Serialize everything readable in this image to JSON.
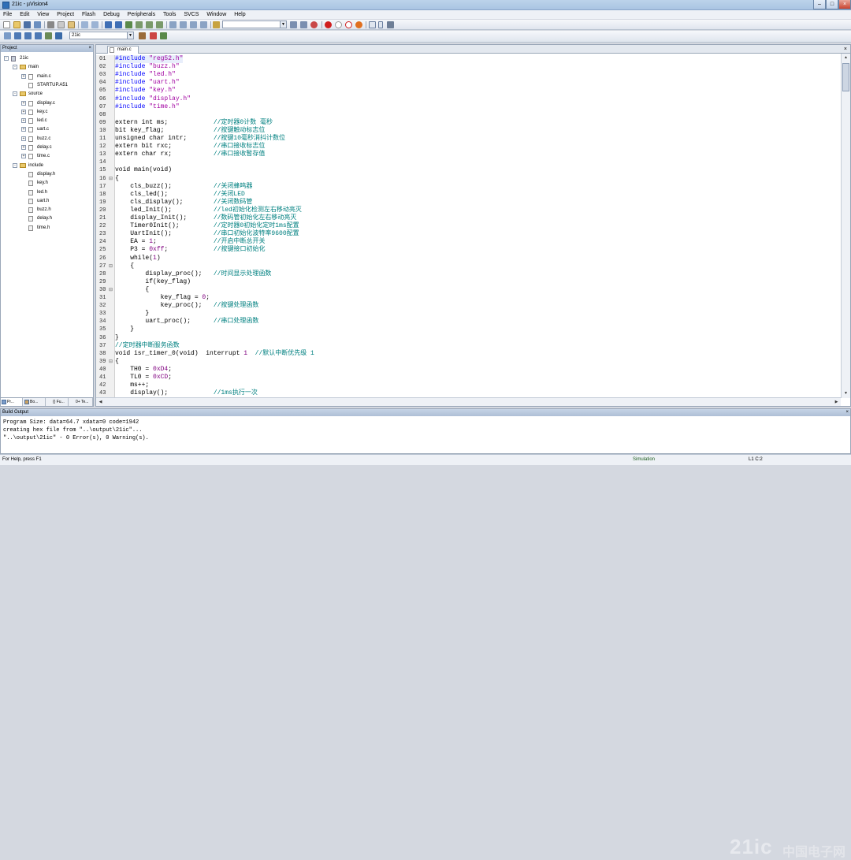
{
  "window": {
    "title": "21ic - µVision4"
  },
  "menu": [
    "File",
    "Edit",
    "View",
    "Project",
    "Flash",
    "Debug",
    "Peripherals",
    "Tools",
    "SVCS",
    "Window",
    "Help"
  ],
  "toolbar2": {
    "target": "21ic"
  },
  "project_pane": {
    "title": "Project",
    "tree": [
      {
        "label": "21ic",
        "level": 0,
        "type": "proj",
        "exp": "-"
      },
      {
        "label": "main",
        "level": 1,
        "type": "fold",
        "exp": "-"
      },
      {
        "label": "main.c",
        "level": 2,
        "type": "file",
        "exp": "+"
      },
      {
        "label": "STARTUP.A51",
        "level": 2,
        "type": "file",
        "exp": ""
      },
      {
        "label": "source",
        "level": 1,
        "type": "fold",
        "exp": "-"
      },
      {
        "label": "display.c",
        "level": 2,
        "type": "file",
        "exp": "+"
      },
      {
        "label": "key.c",
        "level": 2,
        "type": "file",
        "exp": "+"
      },
      {
        "label": "led.c",
        "level": 2,
        "type": "file",
        "exp": "+"
      },
      {
        "label": "uart.c",
        "level": 2,
        "type": "file",
        "exp": "+"
      },
      {
        "label": "buzz.c",
        "level": 2,
        "type": "file",
        "exp": "+"
      },
      {
        "label": "delay.c",
        "level": 2,
        "type": "file",
        "exp": "+"
      },
      {
        "label": "time.c",
        "level": 2,
        "type": "file",
        "exp": "+"
      },
      {
        "label": "include",
        "level": 1,
        "type": "fold",
        "exp": "-"
      },
      {
        "label": "display.h",
        "level": 2,
        "type": "hdr",
        "exp": ""
      },
      {
        "label": "key.h",
        "level": 2,
        "type": "hdr",
        "exp": ""
      },
      {
        "label": "led.h",
        "level": 2,
        "type": "hdr",
        "exp": ""
      },
      {
        "label": "uart.h",
        "level": 2,
        "type": "hdr",
        "exp": ""
      },
      {
        "label": "buzz.h",
        "level": 2,
        "type": "hdr",
        "exp": ""
      },
      {
        "label": "delay.h",
        "level": 2,
        "type": "hdr",
        "exp": ""
      },
      {
        "label": "time.h",
        "level": 2,
        "type": "hdr",
        "exp": ""
      }
    ],
    "tabs": [
      "Pr...",
      "Bo...",
      "{} Fu...",
      "0+ Te..."
    ]
  },
  "editor": {
    "tab": "main.c",
    "lines": [
      {
        "n": "01",
        "fold": "",
        "segs": [
          [
            "kw",
            "#include "
          ],
          [
            "str",
            "\"reg52.h\""
          ]
        ]
      },
      {
        "n": "02",
        "fold": "",
        "segs": [
          [
            "kw",
            "#include "
          ],
          [
            "str",
            "\"buzz.h\""
          ]
        ]
      },
      {
        "n": "03",
        "fold": "",
        "segs": [
          [
            "kw",
            "#include "
          ],
          [
            "str",
            "\"led.h\""
          ]
        ]
      },
      {
        "n": "04",
        "fold": "",
        "segs": [
          [
            "kw",
            "#include "
          ],
          [
            "str",
            "\"uart.h\""
          ]
        ]
      },
      {
        "n": "05",
        "fold": "",
        "segs": [
          [
            "kw",
            "#include "
          ],
          [
            "str",
            "\"key.h\""
          ]
        ]
      },
      {
        "n": "06",
        "fold": "",
        "segs": [
          [
            "kw",
            "#include "
          ],
          [
            "str",
            "\"display.h\""
          ]
        ]
      },
      {
        "n": "07",
        "fold": "",
        "segs": [
          [
            "kw",
            "#include "
          ],
          [
            "str",
            "\"time.h\""
          ]
        ]
      },
      {
        "n": "08",
        "fold": "",
        "segs": []
      },
      {
        "n": "09",
        "fold": "",
        "segs": [
          [
            "b",
            "extern int ms;            "
          ],
          [
            "cm",
            "//定时器0计数 毫秒"
          ]
        ]
      },
      {
        "n": "10",
        "fold": "",
        "segs": [
          [
            "b",
            "bit key_flag;             "
          ],
          [
            "cm",
            "//按键触动标志位"
          ]
        ]
      },
      {
        "n": "11",
        "fold": "",
        "segs": [
          [
            "b",
            "unsigned char intr;       "
          ],
          [
            "cm",
            "//按键10毫秒消抖计数位"
          ]
        ]
      },
      {
        "n": "12",
        "fold": "",
        "segs": [
          [
            "b",
            "extern bit rxc;           "
          ],
          [
            "cm",
            "//串口接收标志位"
          ]
        ]
      },
      {
        "n": "13",
        "fold": "",
        "segs": [
          [
            "b",
            "extern char rx;           "
          ],
          [
            "cm",
            "//串口接收暂存值"
          ]
        ]
      },
      {
        "n": "14",
        "fold": "",
        "segs": []
      },
      {
        "n": "15",
        "fold": "",
        "segs": [
          [
            "b",
            "void main(void)"
          ]
        ]
      },
      {
        "n": "16",
        "fold": "⊟",
        "segs": [
          [
            "t",
            "{"
          ]
        ]
      },
      {
        "n": "17",
        "fold": "",
        "segs": [
          [
            "t",
            "    cls_buzz();           "
          ],
          [
            "cm",
            "//关闭蜂鸣器"
          ]
        ]
      },
      {
        "n": "18",
        "fold": "",
        "segs": [
          [
            "t",
            "    cls_led();            "
          ],
          [
            "cm",
            "//关闭LED"
          ]
        ]
      },
      {
        "n": "19",
        "fold": "",
        "segs": [
          [
            "t",
            "    cls_display();        "
          ],
          [
            "cm",
            "//关闭数码管"
          ]
        ]
      },
      {
        "n": "20",
        "fold": "",
        "segs": [
          [
            "t",
            "    led_Init();           "
          ],
          [
            "cm",
            "//led初始化检测左右移动亮灭"
          ]
        ]
      },
      {
        "n": "21",
        "fold": "",
        "segs": [
          [
            "t",
            "    display_Init();       "
          ],
          [
            "cm",
            "//数码管初始化左右移动亮灭"
          ]
        ]
      },
      {
        "n": "22",
        "fold": "",
        "segs": [
          [
            "t",
            "    Timer0Init();         "
          ],
          [
            "cm",
            "//定时器0初始化定时1ms配置"
          ]
        ]
      },
      {
        "n": "23",
        "fold": "",
        "segs": [
          [
            "t",
            "    UartInit();           "
          ],
          [
            "cm",
            "//串口初始化波特率9600配置"
          ]
        ]
      },
      {
        "n": "24",
        "fold": "",
        "segs": [
          [
            "t",
            "    EA = "
          ],
          [
            "num",
            "1"
          ],
          [
            "t",
            ";               "
          ],
          [
            "cm",
            "//开启中断总开关"
          ]
        ]
      },
      {
        "n": "25",
        "fold": "",
        "segs": [
          [
            "t",
            "    P3 = "
          ],
          [
            "num",
            "0xff"
          ],
          [
            "t",
            ";            "
          ],
          [
            "cm",
            "//按键接口初始化"
          ]
        ]
      },
      {
        "n": "26",
        "fold": "",
        "segs": [
          [
            "b",
            "    while"
          ],
          [
            "t",
            "("
          ],
          [
            "num",
            "1"
          ],
          [
            "t",
            ")"
          ]
        ]
      },
      {
        "n": "27",
        "fold": "⊟",
        "segs": [
          [
            "t",
            "    {"
          ]
        ]
      },
      {
        "n": "28",
        "fold": "",
        "segs": [
          [
            "t",
            "        display_proc();   "
          ],
          [
            "cm",
            "//时间显示处理函数"
          ]
        ]
      },
      {
        "n": "29",
        "fold": "",
        "segs": [
          [
            "b",
            "        if"
          ],
          [
            "t",
            "(key_flag)"
          ]
        ]
      },
      {
        "n": "30",
        "fold": "⊟",
        "segs": [
          [
            "t",
            "        {"
          ]
        ]
      },
      {
        "n": "31",
        "fold": "",
        "segs": [
          [
            "t",
            "            key_flag = "
          ],
          [
            "num",
            "0"
          ],
          [
            "t",
            ";"
          ]
        ]
      },
      {
        "n": "32",
        "fold": "",
        "segs": [
          [
            "t",
            "            key_proc();   "
          ],
          [
            "cm",
            "//按键处理函数"
          ]
        ]
      },
      {
        "n": "33",
        "fold": "",
        "segs": [
          [
            "t",
            "        }"
          ]
        ]
      },
      {
        "n": "34",
        "fold": "",
        "segs": [
          [
            "t",
            "        uart_proc();      "
          ],
          [
            "cm",
            "//串口处理函数"
          ]
        ]
      },
      {
        "n": "35",
        "fold": "",
        "segs": [
          [
            "t",
            "    }"
          ]
        ]
      },
      {
        "n": "36",
        "fold": "",
        "segs": [
          [
            "t",
            "}"
          ]
        ]
      },
      {
        "n": "37",
        "fold": "",
        "segs": [
          [
            "cm",
            "//定时器中断服务函数"
          ]
        ]
      },
      {
        "n": "38",
        "fold": "",
        "segs": [
          [
            "b",
            "void isr_timer_0(void)  interrupt "
          ],
          [
            "num",
            "1"
          ],
          [
            "t",
            "  "
          ],
          [
            "cm",
            "//默认中断优先级 1"
          ]
        ]
      },
      {
        "n": "39",
        "fold": "⊟",
        "segs": [
          [
            "t",
            "{"
          ]
        ]
      },
      {
        "n": "40",
        "fold": "",
        "segs": [
          [
            "t",
            "    TH0 = "
          ],
          [
            "num",
            "0xD4"
          ],
          [
            "t",
            ";"
          ]
        ]
      },
      {
        "n": "41",
        "fold": "",
        "segs": [
          [
            "t",
            "    TL0 = "
          ],
          [
            "num",
            "0xCD"
          ],
          [
            "t",
            ";"
          ]
        ]
      },
      {
        "n": "42",
        "fold": "",
        "segs": [
          [
            "t",
            "    ms++;"
          ]
        ]
      },
      {
        "n": "43",
        "fold": "",
        "segs": [
          [
            "t",
            "    display();            "
          ],
          [
            "cm",
            "//1ms执行一次"
          ]
        ]
      }
    ]
  },
  "build_output": {
    "title": "Build Output",
    "lines": [
      "Program Size: data=64.7 xdata=0 code=1942",
      "creating hex file from \"..\\output\\21ic\"...",
      "\"..\\output\\21ic\" - 0 Error(s), 0 Warning(s)."
    ]
  },
  "status": {
    "help": "For Help, press F1",
    "mode": "Simulation",
    "pos": "L1 C:2"
  },
  "watermark": {
    "text": "21ic",
    "cn": "中国电子网"
  },
  "colors": {
    "keyword": "#0000ff",
    "string": "#a000a0",
    "comment": "#008080",
    "number": "#800080"
  }
}
